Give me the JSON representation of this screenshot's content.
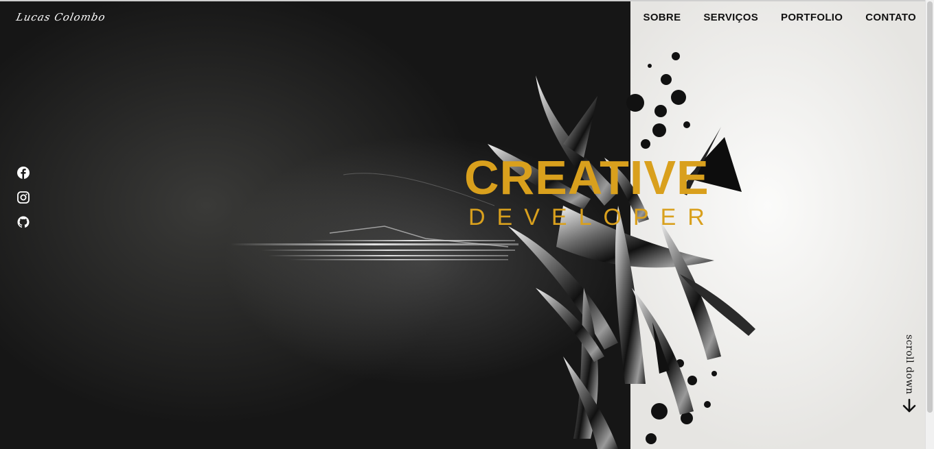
{
  "brand": {
    "logo_text": "Lucas Colombo"
  },
  "nav": {
    "items": [
      {
        "label": "SOBRE"
      },
      {
        "label": "SERVIÇOS"
      },
      {
        "label": "PORTFOLIO"
      },
      {
        "label": "CONTATO"
      }
    ]
  },
  "social": {
    "icons": [
      "facebook-icon",
      "instagram-icon",
      "github-icon"
    ]
  },
  "hero": {
    "title": "CREATIVE",
    "subtitle": "DEVELOPER"
  },
  "scroll": {
    "label": "scroll down",
    "icon": "arrow-down-icon"
  },
  "colors": {
    "accent": "#d9a01d",
    "dark_bg": "#1a1a1a",
    "light_bg": "#eeeeec"
  }
}
